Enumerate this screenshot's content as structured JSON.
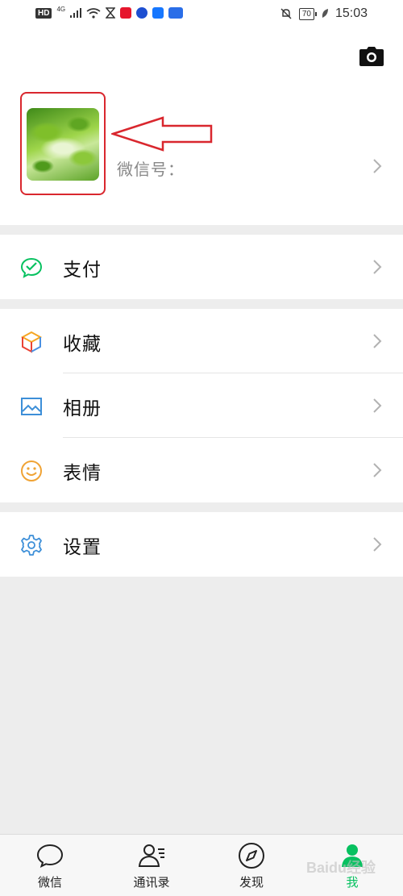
{
  "status_bar": {
    "hd": "HD",
    "network": "4G",
    "battery": "70",
    "time": "15:03"
  },
  "profile": {
    "wechat_id_label": "微信号："
  },
  "menu": [
    {
      "id": "pay",
      "label": "支付",
      "icon": "wechat-pay-icon"
    },
    {
      "id": "favorites",
      "label": "收藏",
      "icon": "favorites-cube-icon"
    },
    {
      "id": "album",
      "label": "相册",
      "icon": "album-picture-icon"
    },
    {
      "id": "stickers",
      "label": "表情",
      "icon": "smiley-icon"
    },
    {
      "id": "settings",
      "label": "设置",
      "icon": "gear-icon"
    }
  ],
  "tabbar": [
    {
      "label": "微信",
      "icon": "chat-bubble-icon"
    },
    {
      "label": "通讯录",
      "icon": "contacts-icon"
    },
    {
      "label": "发现",
      "icon": "compass-icon"
    },
    {
      "label": "我",
      "icon": "me-person-icon",
      "active": true
    }
  ],
  "watermark": "Baidu经验",
  "colors": {
    "accent": "#07c160",
    "highlight": "#d9272e"
  }
}
